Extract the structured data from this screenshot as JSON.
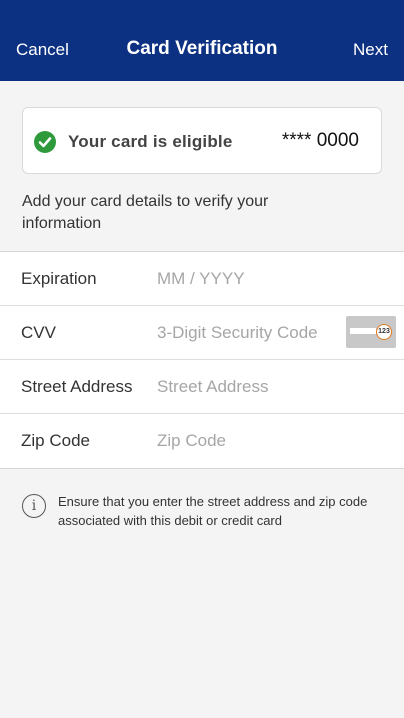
{
  "header": {
    "cancel_label": "Cancel",
    "title": "Card Verification",
    "next_label": "Next"
  },
  "eligibility": {
    "text": "Your card is eligible",
    "card_mask": "**** 0000",
    "icon": "checkmark-circle-icon",
    "icon_color": "#2f9a3c"
  },
  "intro": "Add your card details to verify your information",
  "fields": [
    {
      "label": "Expiration",
      "placeholder": "MM / YYYY",
      "value": ""
    },
    {
      "label": "CVV",
      "placeholder": "3-Digit Security Code",
      "value": "",
      "icon_text": "123",
      "icon": "card-cvv-icon"
    },
    {
      "label": "Street Address",
      "placeholder": "Street Address",
      "value": ""
    },
    {
      "label": "Zip Code",
      "placeholder": "Zip Code",
      "value": ""
    }
  ],
  "info": {
    "icon": "info-icon",
    "icon_glyph": "i",
    "text": "Ensure that you enter the street address and zip code associated with this debit or credit card"
  },
  "colors": {
    "header_bg": "#0d3182",
    "page_bg": "#f4f4f4",
    "placeholder": "#a6a6a6",
    "cvv_accent": "#e07b1e"
  }
}
